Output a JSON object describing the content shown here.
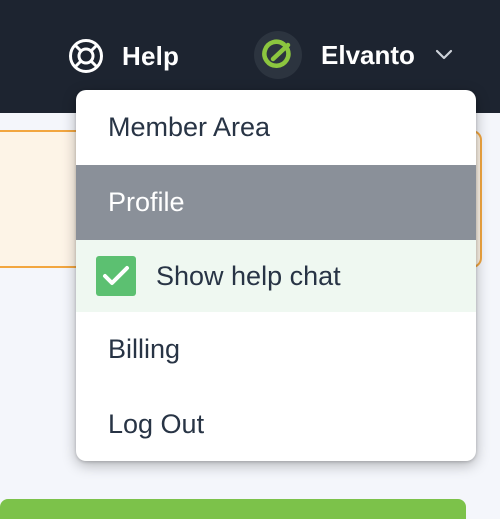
{
  "header": {
    "help_label": "Help",
    "org_name": "Elvanto",
    "colors": {
      "bar": "#1d2430",
      "logo_accent": "#8cc63f"
    }
  },
  "menu": {
    "items": [
      {
        "label": "Member Area",
        "state": "normal"
      },
      {
        "label": "Profile",
        "state": "hover"
      },
      {
        "label": "Show help chat",
        "state": "checked"
      },
      {
        "label": "Billing",
        "state": "normal"
      },
      {
        "label": "Log Out",
        "state": "normal"
      }
    ],
    "colors": {
      "hover_bg": "#8a9099",
      "checked_bg": "#eff8f1",
      "checkbox": "#5cc071"
    }
  },
  "icons": {
    "help": "lifebuoy-icon",
    "logo": "elvanto-logo-icon",
    "dropdown": "chevron-down-icon",
    "checkbox": "checkmark-icon"
  }
}
